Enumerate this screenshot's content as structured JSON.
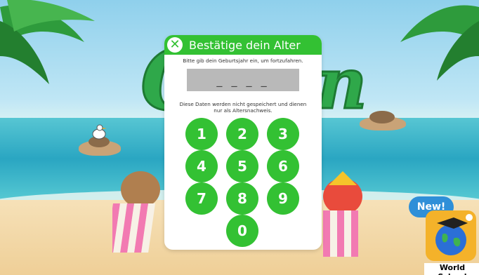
{
  "dialog": {
    "title": "Bestätige dein Alter",
    "prompt": "Bitte gib dein Geburtsjahr ein, um fortzufahren.",
    "year_placeholder": "_ _ _ _",
    "notice": "Diese Daten werden nicht gespeichert und dienen nur als Altersnachweis.",
    "keys": [
      "1",
      "2",
      "3",
      "4",
      "5",
      "6",
      "7",
      "8",
      "9",
      "0"
    ]
  },
  "promo": {
    "badge": "New!",
    "label": "World School"
  },
  "colors": {
    "accent": "#33c133",
    "badge": "#2f8fd8"
  }
}
